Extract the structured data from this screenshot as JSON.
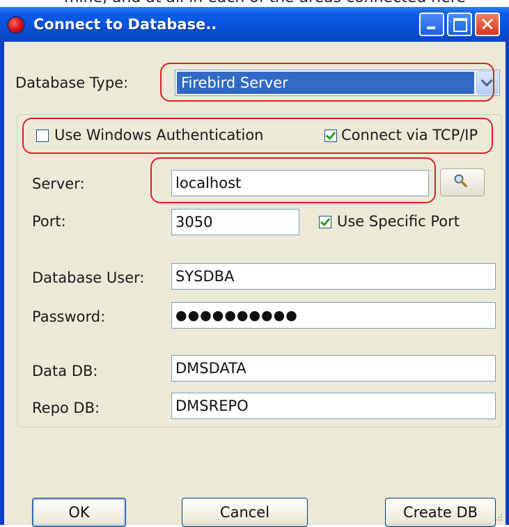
{
  "background_text": "mine, and at all in each of the areas connected here",
  "window": {
    "title": "Connect to Database..",
    "controls": {
      "minimize_icon": "minimize-icon",
      "maximize_icon": "maximize-icon",
      "close_icon": "close-icon"
    }
  },
  "form": {
    "database_type": {
      "label": "Database Type:",
      "value": "Firebird Server"
    },
    "use_windows_auth": {
      "label": "Use Windows Authentication",
      "checked": false
    },
    "connect_tcpip": {
      "label": "Connect via TCP/IP",
      "checked": true
    },
    "server": {
      "label": "Server:",
      "value": "localhost"
    },
    "port": {
      "label": "Port:",
      "value": "3050"
    },
    "use_specific_port": {
      "label": "Use Specific Port",
      "checked": true
    },
    "database_user": {
      "label": "Database User:",
      "value": "SYSDBA"
    },
    "password": {
      "label": "Password:",
      "value": "●●●●●●●●●●"
    },
    "data_db": {
      "label": "Data DB:",
      "value": "DMSDATA"
    },
    "repo_db": {
      "label": "Repo DB:",
      "value": "DMSREPO"
    }
  },
  "buttons": {
    "ok": "OK",
    "cancel": "Cancel",
    "create_db": "Create DB"
  },
  "colors": {
    "title_bar": "#0a5ce8",
    "annotation": "#e02020",
    "selection": "#316ac5"
  }
}
